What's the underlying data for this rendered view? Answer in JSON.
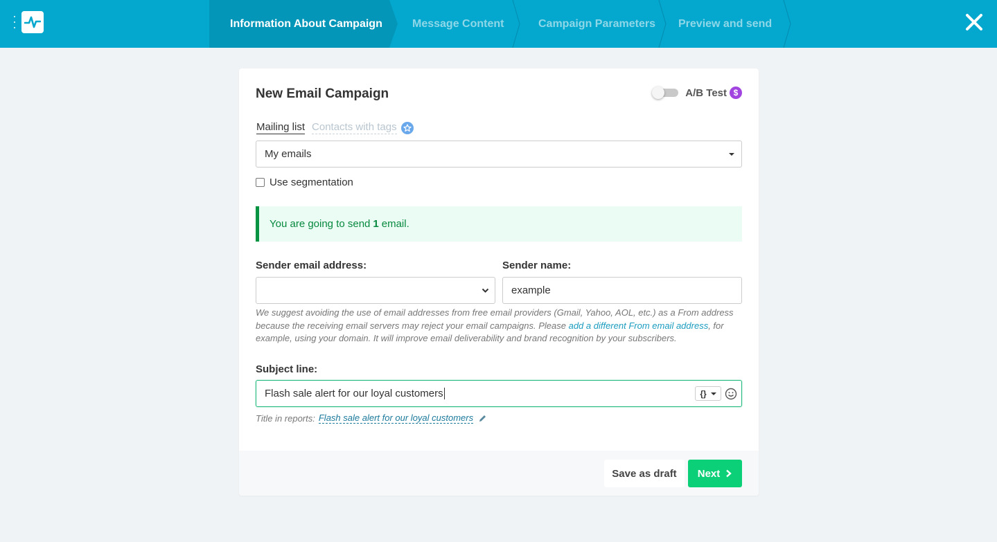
{
  "header": {
    "steps": [
      {
        "label": "Information About Campaign",
        "active": true
      },
      {
        "label": "Message Content",
        "active": false
      },
      {
        "label": "Campaign Parameters",
        "active": false
      },
      {
        "label": "Preview and send",
        "active": false
      }
    ],
    "close_icon": "close-icon"
  },
  "card": {
    "title": "New Email Campaign",
    "ab_test": {
      "label": "A/B Test",
      "enabled": false,
      "badge": "$"
    },
    "tabs": {
      "mailing_list": "Mailing list",
      "contacts_with_tags": "Contacts with tags"
    },
    "mailing_list_value": "My emails",
    "use_segmentation": {
      "label": "Use segmentation",
      "checked": false
    },
    "notice": {
      "prefix": "You are going to send",
      "count": "1",
      "suffix": "email."
    },
    "sender_email": {
      "label": "Sender email address:",
      "value": ""
    },
    "sender_name": {
      "label": "Sender name:",
      "value": "example"
    },
    "hint": {
      "text_before": "We suggest avoiding the use of email addresses from free email providers (Gmail, Yahoo, AOL, etc.) as a From address because the receiving email servers may reject your email campaigns. Please ",
      "link": "add a different From email address",
      "text_after": ", for example, using your domain. It will improve email deliverability and brand recognition by your subscribers."
    },
    "subject": {
      "label": "Subject line:",
      "value": "Flash sale alert for our loyal customers",
      "var_button": "{}"
    },
    "report_title": {
      "label": "Title in reports:",
      "value": "Flash sale alert for our loyal customers"
    },
    "footer": {
      "save_draft": "Save as draft",
      "next": "Next"
    }
  },
  "colors": {
    "topbar": "#04a7cd",
    "active_step": "#0396b8",
    "next_button": "#0cd077",
    "notice_text": "#07893f",
    "subject_border": "#1fba7b"
  }
}
